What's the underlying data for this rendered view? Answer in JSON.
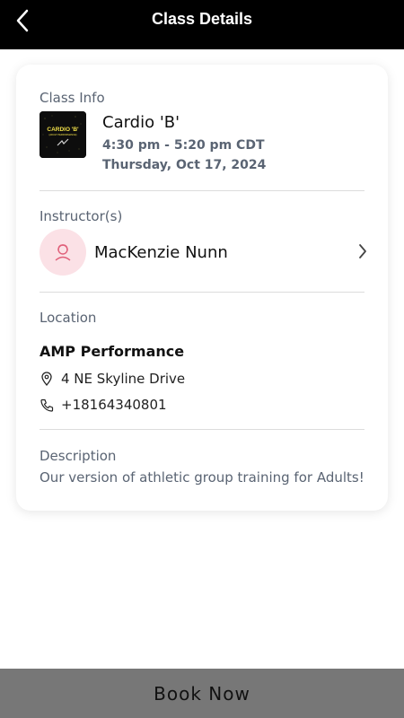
{
  "header": {
    "title": "Class Details",
    "back_icon": "chevron-left-icon"
  },
  "class_info": {
    "label": "Class Info",
    "thumbnail_icon": "class-thumbnail-image",
    "thumbnail_title": "CARDIO 'B'",
    "thumbnail_subtitle": "(ADULT PERFORMANCE)",
    "name": "Cardio 'B'",
    "time": "4:30 pm - 5:20 pm CDT",
    "date": "Thursday, Oct 17, 2024"
  },
  "instructors": {
    "label": "Instructor(s)",
    "items": [
      {
        "name": "MacKenzie Nunn",
        "avatar_icon": "person-icon"
      }
    ]
  },
  "location": {
    "label": "Location",
    "name": "AMP Performance",
    "address": "4 NE Skyline Drive",
    "phone": "+18164340801"
  },
  "description": {
    "label": "Description",
    "text": "Our version of athletic group training for Adults!"
  },
  "footer": {
    "book_label": "Book Now"
  },
  "colors": {
    "header_bg": "#000000",
    "muted_text": "#5a6473",
    "avatar_bg": "#fbe1e6",
    "avatar_icon": "#e0607a",
    "button_bg": "#777777"
  }
}
